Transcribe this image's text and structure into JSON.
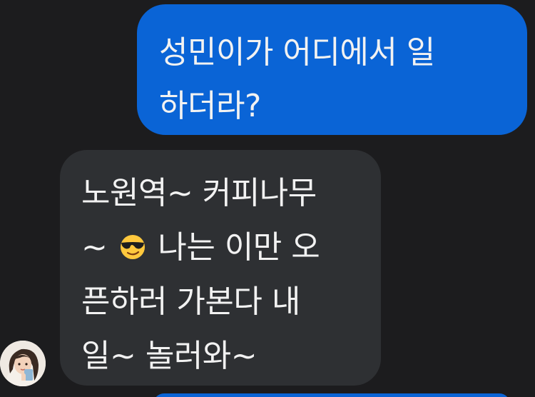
{
  "conversation": {
    "outgoing_message": {
      "lines": [
        "성민이가 어디에서 일",
        "하더라?"
      ]
    },
    "incoming_message": {
      "line1": "노원역~ 커피나무",
      "line2_prefix": "~",
      "line2_emoji": "smiling-face-with-sunglasses",
      "line2_suffix": "나는 이만 오",
      "line3": "픈하러 가본다 내",
      "line4": "일~ 놀러와~"
    }
  },
  "colors": {
    "background": "#1c1c1e",
    "outgoing_bubble": "#0a64d6",
    "incoming_bubble": "#2e3033",
    "text": "#f2f2f2"
  }
}
